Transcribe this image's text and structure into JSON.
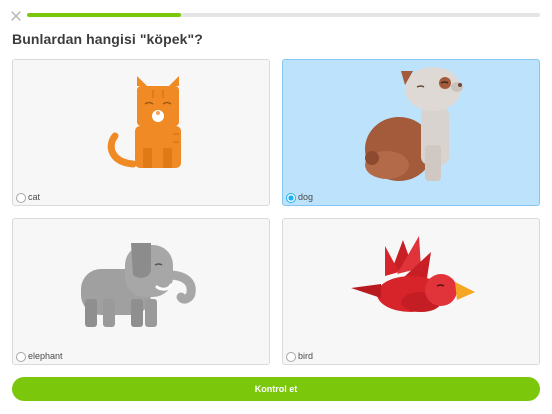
{
  "header": {
    "close_icon": "close-icon",
    "progress_fraction": 0.3
  },
  "question": "Bunlardan hangisi \"köpek\"?",
  "options": [
    {
      "label": "cat",
      "icon": "cat-illustration",
      "selected": false
    },
    {
      "label": "dog",
      "icon": "dog-illustration",
      "selected": true
    },
    {
      "label": "elephant",
      "icon": "elephant-illustration",
      "selected": false
    },
    {
      "label": "bird",
      "icon": "bird-illustration",
      "selected": false
    }
  ],
  "check_button_label": "Kontrol et",
  "colors": {
    "accent_green": "#7ac70c",
    "selected_blue": "#bde2fb",
    "cat": "#f08a24",
    "dog": "#a45b3b",
    "elephant": "#a0a0a0",
    "bird": "#d7242b"
  }
}
